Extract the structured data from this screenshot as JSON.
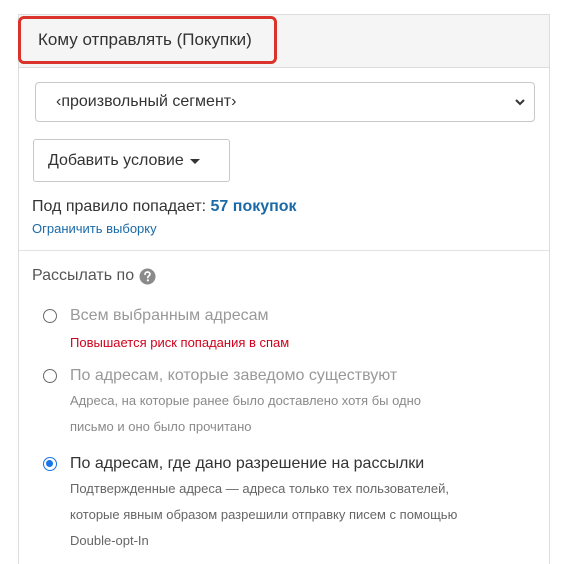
{
  "panel": {
    "title": "Кому отправлять (Покупки)"
  },
  "segment_select": {
    "value": "‹произвольный сегмент›"
  },
  "add_condition_button": {
    "label": "Добавить условие"
  },
  "rule": {
    "prefix": "Под правило попадает: ",
    "count": "57 покупок",
    "limit_link": "Ограничить выборку"
  },
  "send_by": {
    "label": "Рассылать по",
    "options": [
      {
        "label": "Всем выбранным адресам",
        "warning": "Повышается риск попадания в спам",
        "checked": false
      },
      {
        "label": "По адресам, которые заведомо существуют",
        "desc_lines": [
          "Адреса, на которые ранее было доставлено хотя бы одно",
          "письмо и оно было прочитано"
        ],
        "checked": false
      },
      {
        "label": "По адресам, где дано разрешение на рассылки",
        "desc_lines": [
          "Подтвержденные адреса — адреса только тех пользователей,",
          "которые явным образом разрешили отправку писем с помощью",
          "Double-opt-In"
        ],
        "checked": true
      }
    ]
  },
  "colors": {
    "highlight_border": "#d9332b",
    "link": "#1a6aa8",
    "warning": "#d0021b",
    "radio_checked": "#1a73e8"
  }
}
